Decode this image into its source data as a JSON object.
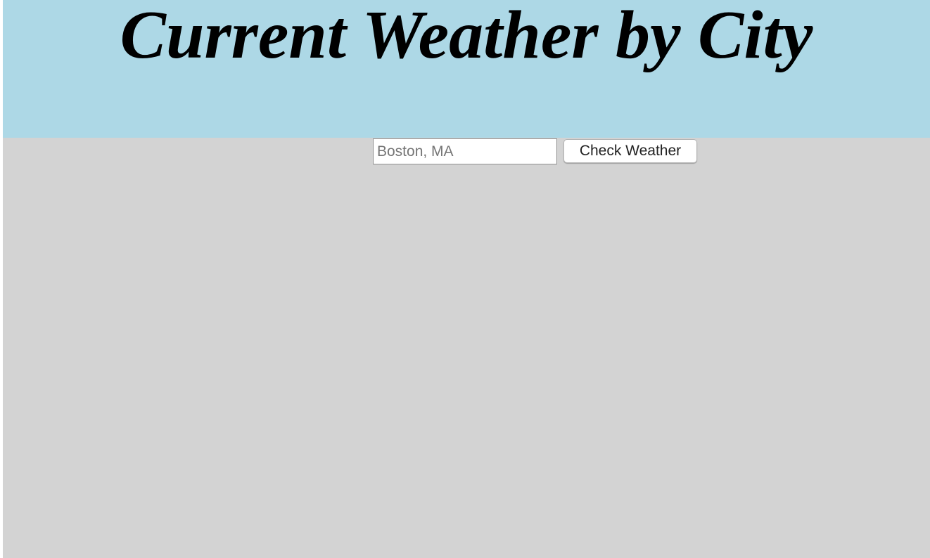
{
  "header": {
    "title": "Current Weather by City"
  },
  "search": {
    "value": "",
    "placeholder": "Boston, MA",
    "button_label": "Check Weather"
  },
  "colors": {
    "header_background": "#add8e6",
    "page_background": "#d3d3d3"
  }
}
